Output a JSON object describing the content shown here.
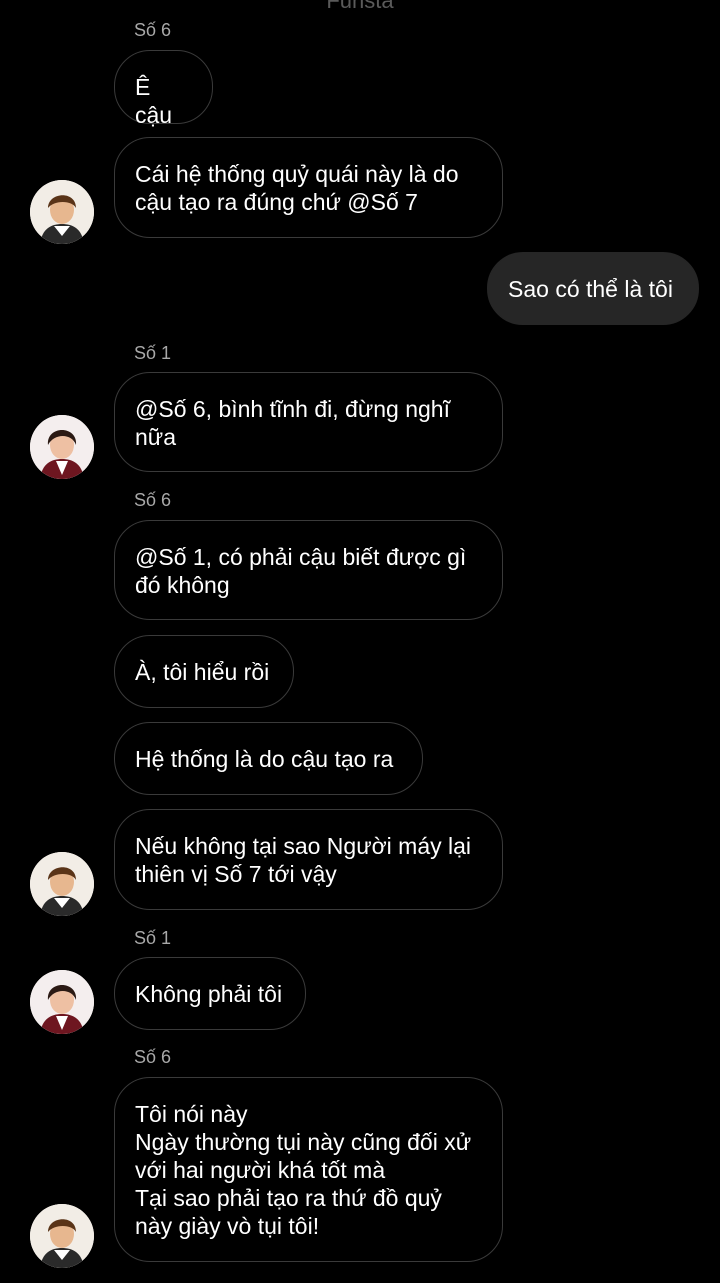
{
  "header": {
    "title": "Funsta"
  },
  "colors": {
    "background": "#000000",
    "incoming_border": "#3a3a3a",
    "outgoing_bg": "#262626",
    "sender_label": "#a8a8a8"
  },
  "messages": [
    {
      "type": "sender",
      "text": "Số 6"
    },
    {
      "type": "incoming",
      "text": "Ê cậu"
    },
    {
      "type": "incoming",
      "text": "Cái hệ thống quỷ quái này là do\ncậu tạo ra đúng chứ @Số 7",
      "avatar": "avatar-so-6"
    },
    {
      "type": "outgoing",
      "text": "Sao có thể là tôi"
    },
    {
      "type": "sender",
      "text": "Số 1"
    },
    {
      "type": "incoming",
      "text": "@Số 6, bình tĩnh đi, đừng nghĩ\nnữa",
      "avatar": "avatar-so-1"
    },
    {
      "type": "sender",
      "text": "Số 6"
    },
    {
      "type": "incoming",
      "text": "@Số 1, có phải cậu biết được gì\nđó không"
    },
    {
      "type": "incoming",
      "text": "À, tôi hiểu rồi"
    },
    {
      "type": "incoming",
      "text": "Hệ thống là do cậu tạo ra"
    },
    {
      "type": "incoming",
      "text": "Nếu không tại sao Người máy lại\nthiên vị Số 7 tới vậy",
      "avatar": "avatar-so-6"
    },
    {
      "type": "sender",
      "text": "Số 1"
    },
    {
      "type": "incoming",
      "text": "Không phải tôi",
      "avatar": "avatar-so-1"
    },
    {
      "type": "sender",
      "text": "Số 6"
    },
    {
      "type": "incoming",
      "text": "Tôi nói này\nNgày thường tụi này cũng đối xử\nvới hai người khá tốt mà\nTại sao phải tạo ra thứ đồ quỷ\nnày giày vò tụi tôi!",
      "avatar": "avatar-so-6"
    }
  ]
}
